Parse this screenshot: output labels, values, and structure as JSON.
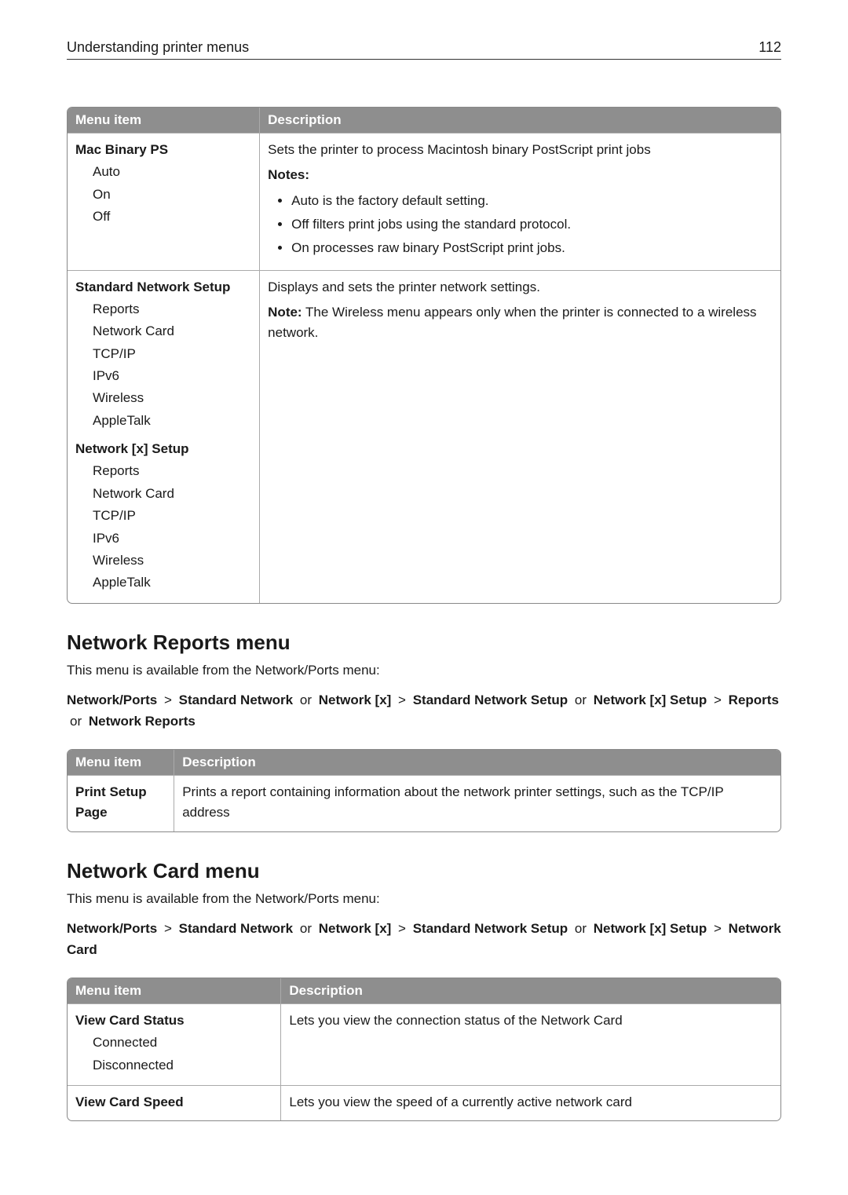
{
  "header": {
    "title": "Understanding printer menus",
    "pageNumber": "112"
  },
  "table1": {
    "headers": [
      "Menu item",
      "Description"
    ],
    "rows": [
      {
        "item": {
          "title": "Mac Binary PS",
          "subs": [
            "Auto",
            "On",
            "Off"
          ]
        },
        "desc": {
          "intro": "Sets the printer to process Macintosh binary PostScript print jobs",
          "notesLabel": "Notes:",
          "bullets": [
            "Auto is the factory default setting.",
            "Off filters print jobs using the standard protocol.",
            "On processes raw binary PostScript print jobs."
          ]
        }
      },
      {
        "item": {
          "groups": [
            {
              "title": "Standard Network Setup",
              "subs": [
                "Reports",
                "Network Card",
                "TCP/IP",
                "IPv6",
                "Wireless",
                "AppleTalk"
              ]
            },
            {
              "title": "Network [x] Setup",
              "subs": [
                "Reports",
                "Network Card",
                "TCP/IP",
                "IPv6",
                "Wireless",
                "AppleTalk"
              ]
            }
          ]
        },
        "desc": {
          "intro": "Displays and sets the printer network settings.",
          "noteLabel": "Note:",
          "noteText": " The Wireless menu appears only when the printer is connected to a wireless network."
        }
      }
    ]
  },
  "section1": {
    "heading": "Network Reports menu",
    "intro": "This menu is available from the Network/Ports menu:",
    "path": {
      "p1": "Network/Ports",
      "sep": ">",
      "p2": "Standard Network",
      "or": "or",
      "p3": "Network [x]",
      "p4": "Standard Network Setup",
      "p5": "Network [x] Setup",
      "p6": "Reports",
      "p7": "Network Reports"
    }
  },
  "table2": {
    "headers": [
      "Menu item",
      "Description"
    ],
    "row": {
      "item": "Print Setup Page",
      "desc": "Prints a report containing information about the network printer settings, such as the TCP/IP address"
    }
  },
  "section2": {
    "heading": "Network Card menu",
    "intro": "This menu is available from the Network/Ports menu:",
    "path": {
      "p1": "Network/Ports",
      "sep": ">",
      "p2": "Standard Network",
      "or": "or",
      "p3": "Network [x]",
      "p4": "Standard Network Setup",
      "p5": "Network [x] Setup",
      "p6": "Network Card"
    }
  },
  "table3": {
    "headers": [
      "Menu item",
      "Description"
    ],
    "rows": [
      {
        "item": {
          "title": "View Card Status",
          "subs": [
            "Connected",
            "Disconnected"
          ]
        },
        "desc": "Lets you view the connection status of the Network Card"
      },
      {
        "item": {
          "title": "View Card Speed"
        },
        "desc": "Lets you view the speed of a currently active network card"
      }
    ]
  }
}
